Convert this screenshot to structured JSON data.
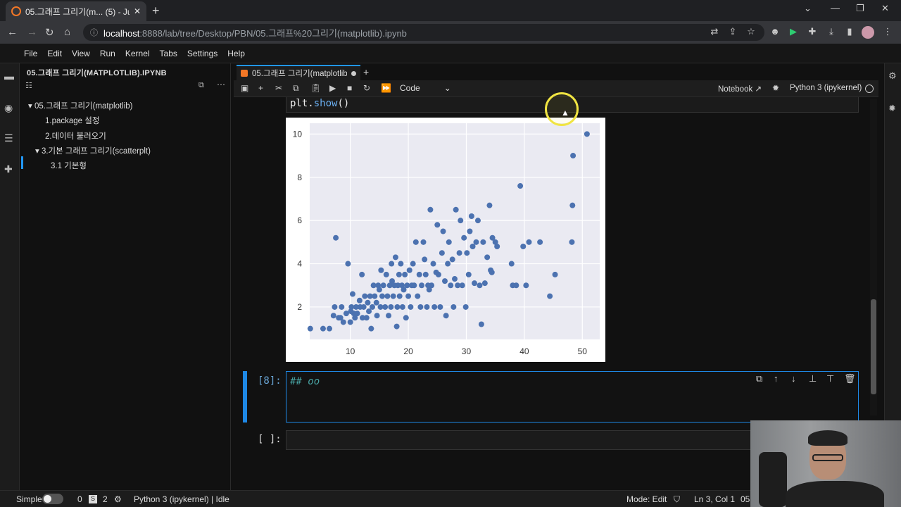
{
  "browser": {
    "tab_title": "05.그래프 그리기(m... (5) - Jupy",
    "url_host": "localhost",
    "url_path": ":8888/lab/tree/Desktop/PBN/05.그래프%20그리기(matplotlib).ipynb"
  },
  "menu": [
    "File",
    "Edit",
    "View",
    "Run",
    "Kernel",
    "Tabs",
    "Settings",
    "Help"
  ],
  "toc": {
    "title": "05.그래프 그리기(MATPLOTLIB).IPYNB",
    "items": [
      {
        "label": "05.그래프 그리기(matplotlib)"
      },
      {
        "label": "1.package 설정"
      },
      {
        "label": "2.데이터 불러오기"
      },
      {
        "label": "3.기본 그래프 그리기(scatterplt)"
      },
      {
        "label": "3.1 기본형"
      }
    ]
  },
  "notebook": {
    "tab_label": "05.그래프 그리기(matplotlib",
    "cell_type": "Code",
    "notebook_link": "Notebook",
    "kernel": "Python 3 (ipykernel)",
    "prev_code_obj": "plt.",
    "prev_code_fn": "show",
    "prev_code_tail": "()",
    "cell8_prompt": "[8]:",
    "cell8_text": "## oo",
    "cell9_prompt": "[ ]:"
  },
  "statusbar": {
    "mode": "Simple",
    "count0": "0",
    "count2": "2",
    "kernel_status": "Python 3 (ipykernel) | Idle",
    "edit_mode": "Mode: Edit",
    "position": "Ln 3, Col 1",
    "file_short": "05."
  },
  "chart_data": {
    "type": "scatter",
    "title": "",
    "xlabel": "",
    "ylabel": "",
    "xlim": [
      3,
      53
    ],
    "ylim": [
      0.5,
      10.5
    ],
    "xticks": [
      10,
      20,
      30,
      40,
      50
    ],
    "yticks": [
      2,
      4,
      6,
      8,
      10
    ],
    "grid": true,
    "color": "#4c72b0",
    "points": [
      [
        3.1,
        1.0
      ],
      [
        5.3,
        1.0
      ],
      [
        6.4,
        1.0
      ],
      [
        7.1,
        1.6
      ],
      [
        7.3,
        2.0
      ],
      [
        7.5,
        5.2
      ],
      [
        8.0,
        1.5
      ],
      [
        8.3,
        1.5
      ],
      [
        8.5,
        2.0
      ],
      [
        8.8,
        1.3
      ],
      [
        9.3,
        1.7
      ],
      [
        9.6,
        4.0
      ],
      [
        10.0,
        1.3
      ],
      [
        10.1,
        1.8
      ],
      [
        10.2,
        2.0
      ],
      [
        10.4,
        2.6
      ],
      [
        10.6,
        1.7
      ],
      [
        10.8,
        1.5
      ],
      [
        11.0,
        2.0
      ],
      [
        11.2,
        1.7
      ],
      [
        11.6,
        2.3
      ],
      [
        11.7,
        2.0
      ],
      [
        12.0,
        3.5
      ],
      [
        12.1,
        1.5
      ],
      [
        12.3,
        2.0
      ],
      [
        12.5,
        2.5
      ],
      [
        12.8,
        1.5
      ],
      [
        13.0,
        2.2
      ],
      [
        13.2,
        1.8
      ],
      [
        13.4,
        2.5
      ],
      [
        13.6,
        1.0
      ],
      [
        13.8,
        2.0
      ],
      [
        14.0,
        3.0
      ],
      [
        14.2,
        2.5
      ],
      [
        14.5,
        2.2
      ],
      [
        14.6,
        1.6
      ],
      [
        14.8,
        3.0
      ],
      [
        15.0,
        2.8
      ],
      [
        15.2,
        2.0
      ],
      [
        15.3,
        3.7
      ],
      [
        15.5,
        2.5
      ],
      [
        15.7,
        3.0
      ],
      [
        16.0,
        2.0
      ],
      [
        16.2,
        3.5
      ],
      [
        16.4,
        2.5
      ],
      [
        16.6,
        1.6
      ],
      [
        16.8,
        3.0
      ],
      [
        17.0,
        2.0
      ],
      [
        17.1,
        4.0
      ],
      [
        17.2,
        3.2
      ],
      [
        17.4,
        2.5
      ],
      [
        17.6,
        3.0
      ],
      [
        17.8,
        4.3
      ],
      [
        18.0,
        1.1
      ],
      [
        18.1,
        2.0
      ],
      [
        18.2,
        3.0
      ],
      [
        18.4,
        3.5
      ],
      [
        18.5,
        2.5
      ],
      [
        18.7,
        4.0
      ],
      [
        18.9,
        3.0
      ],
      [
        19.0,
        2.0
      ],
      [
        19.2,
        2.8
      ],
      [
        19.4,
        3.5
      ],
      [
        19.6,
        1.5
      ],
      [
        19.8,
        3.0
      ],
      [
        20.0,
        2.5
      ],
      [
        20.2,
        3.7
      ],
      [
        20.4,
        2.0
      ],
      [
        20.6,
        3.0
      ],
      [
        20.8,
        4.0
      ],
      [
        21.0,
        3.0
      ],
      [
        21.3,
        5.0
      ],
      [
        21.6,
        2.5
      ],
      [
        21.9,
        3.5
      ],
      [
        22.1,
        2.0
      ],
      [
        22.3,
        3.0
      ],
      [
        22.6,
        5.0
      ],
      [
        22.8,
        4.2
      ],
      [
        23.0,
        3.5
      ],
      [
        23.2,
        2.0
      ],
      [
        23.4,
        3.0
      ],
      [
        23.6,
        2.8
      ],
      [
        23.8,
        6.5
      ],
      [
        24.0,
        3.0
      ],
      [
        24.3,
        4.0
      ],
      [
        24.5,
        2.0
      ],
      [
        24.8,
        3.6
      ],
      [
        25.0,
        5.8
      ],
      [
        25.2,
        3.5
      ],
      [
        25.5,
        2.0
      ],
      [
        25.8,
        4.5
      ],
      [
        26.0,
        5.5
      ],
      [
        26.3,
        3.2
      ],
      [
        26.5,
        1.6
      ],
      [
        26.8,
        4.0
      ],
      [
        27.0,
        5.0
      ],
      [
        27.3,
        3.0
      ],
      [
        27.6,
        4.2
      ],
      [
        27.8,
        2.0
      ],
      [
        28.0,
        3.3
      ],
      [
        28.2,
        6.5
      ],
      [
        28.5,
        3.0
      ],
      [
        28.8,
        4.5
      ],
      [
        29.0,
        6.0
      ],
      [
        29.3,
        3.0
      ],
      [
        29.6,
        5.2
      ],
      [
        29.9,
        2.0
      ],
      [
        30.1,
        4.5
      ],
      [
        30.4,
        3.5
      ],
      [
        30.6,
        5.5
      ],
      [
        30.9,
        6.2
      ],
      [
        31.1,
        4.8
      ],
      [
        31.4,
        3.1
      ],
      [
        31.7,
        5.0
      ],
      [
        32.0,
        6.0
      ],
      [
        32.3,
        3.0
      ],
      [
        32.6,
        1.2
      ],
      [
        32.9,
        5.0
      ],
      [
        33.2,
        3.1
      ],
      [
        33.6,
        4.3
      ],
      [
        34.0,
        6.7
      ],
      [
        34.2,
        3.7
      ],
      [
        34.4,
        3.6
      ],
      [
        34.5,
        5.2
      ],
      [
        35.0,
        5.0
      ],
      [
        35.3,
        4.8
      ],
      [
        37.8,
        4.0
      ],
      [
        38.0,
        3.0
      ],
      [
        38.6,
        3.0
      ],
      [
        39.3,
        7.6
      ],
      [
        39.8,
        4.8
      ],
      [
        40.3,
        3.0
      ],
      [
        40.8,
        5.0
      ],
      [
        42.7,
        5.0
      ],
      [
        44.4,
        2.5
      ],
      [
        45.3,
        3.5
      ],
      [
        48.2,
        5.0
      ],
      [
        48.3,
        6.7
      ],
      [
        48.4,
        9.0
      ],
      [
        50.8,
        10.0
      ]
    ]
  }
}
